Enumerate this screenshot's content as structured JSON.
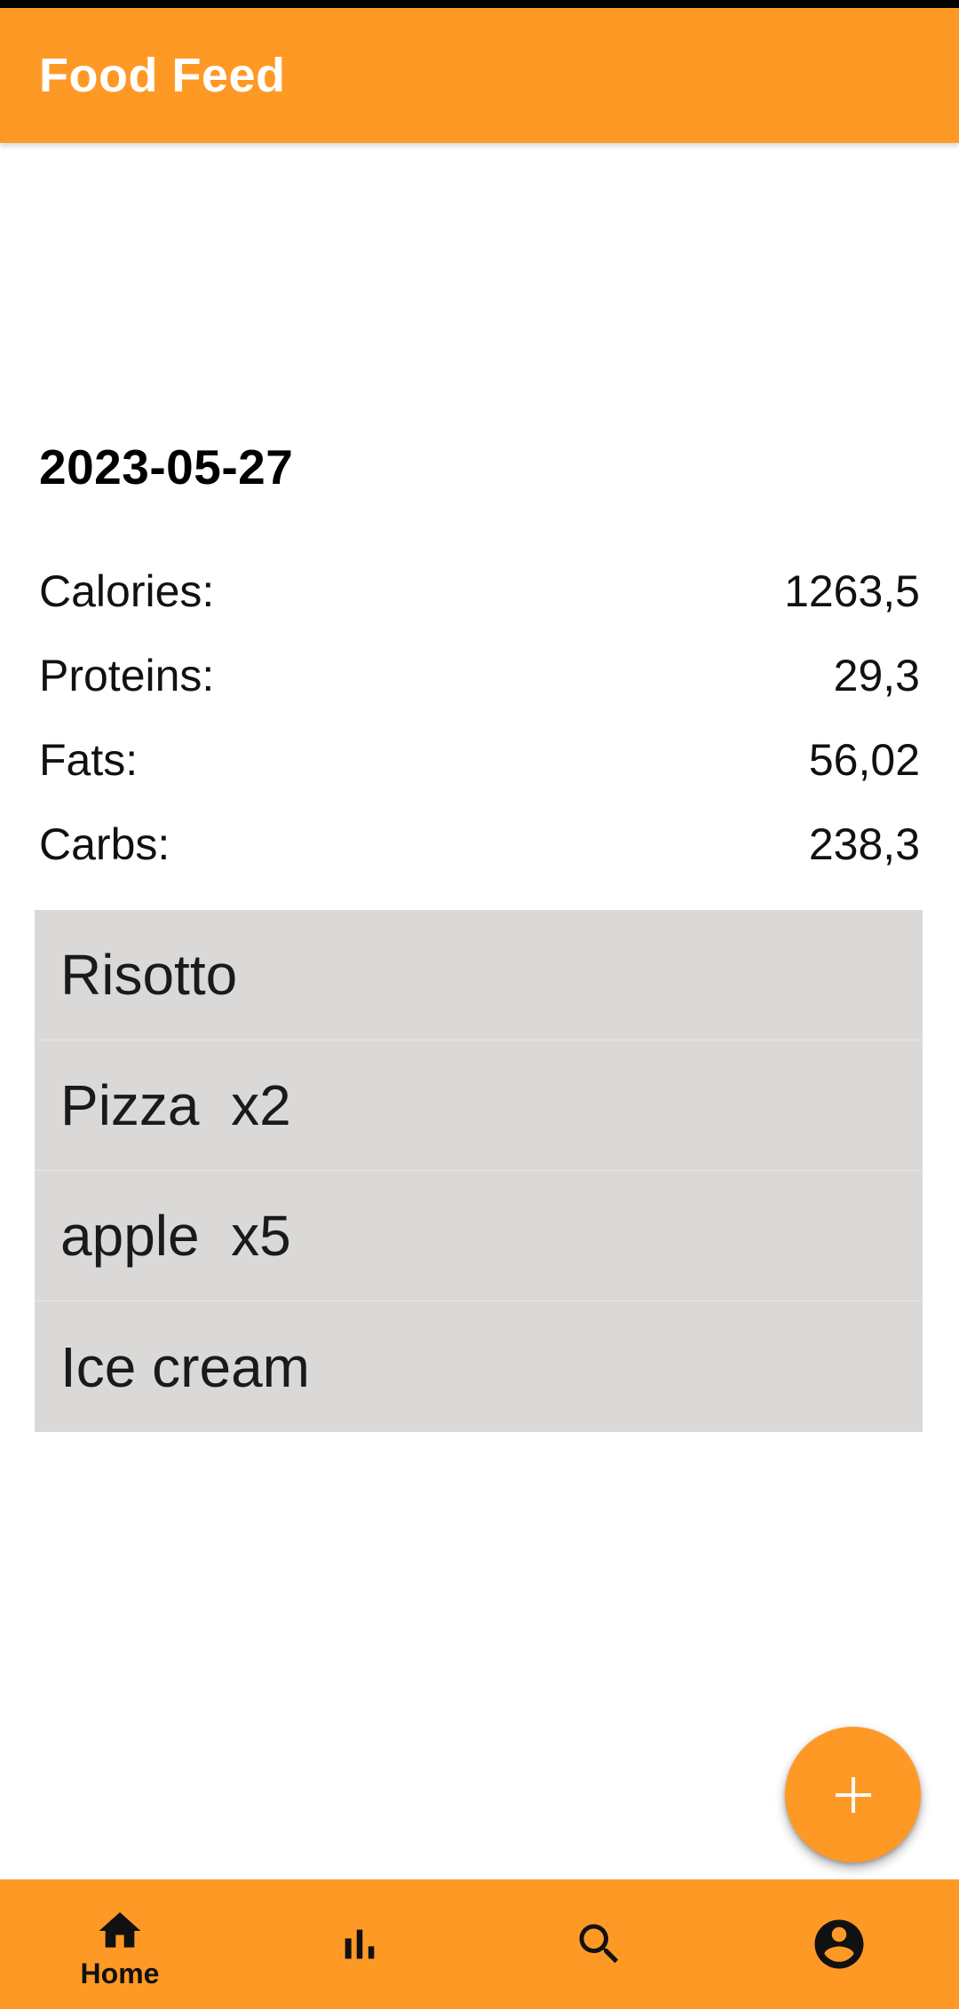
{
  "app_bar": {
    "title": "Food Feed"
  },
  "day": {
    "date": "2023-05-27",
    "nutrients": [
      {
        "label": "Calories:",
        "value": "1263,5"
      },
      {
        "label": "Proteins:",
        "value": "29,3"
      },
      {
        "label": "Fats:",
        "value": "56,02"
      },
      {
        "label": "Carbs:",
        "value": "238,3"
      }
    ],
    "foods": [
      {
        "label": "Risotto"
      },
      {
        "label": "Pizza  x2"
      },
      {
        "label": "apple  x5"
      },
      {
        "label": "Ice cream"
      }
    ]
  },
  "fab": {
    "icon": "plus-icon"
  },
  "bottom_nav": {
    "items": [
      {
        "label": "Home",
        "icon": "home-icon",
        "active": true
      },
      {
        "label": "",
        "icon": "bar-chart-icon",
        "active": false
      },
      {
        "label": "",
        "icon": "search-icon",
        "active": false
      },
      {
        "label": "",
        "icon": "account-icon",
        "active": false
      }
    ]
  },
  "colors": {
    "primary": "#FF9926",
    "list_background": "#DBD9D8",
    "on_primary_text": "#FFFFFF",
    "status_bar": "#000000"
  }
}
